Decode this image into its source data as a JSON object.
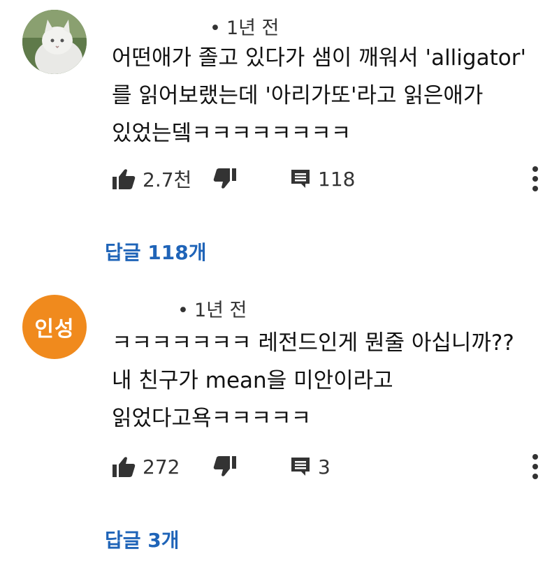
{
  "comments": [
    {
      "time": "1년 전",
      "avatar_text": "",
      "lines": [
        "어떤애가 졸고 있다가 샘이 깨워서 'alligator'",
        "를 읽어보랬는데 '아리가또'라고 읽은애가",
        "있었는뎈ㅋㅋㅋㅋㅋㅋㅋㅋ"
      ],
      "likes": "2.7천",
      "reply_count": "118",
      "replies_label": "답글 118개"
    },
    {
      "time": "1년 전",
      "avatar_text": "인성",
      "lines": [
        "ㅋㅋㅋㅋㅋㅋㅋ 레전드인게 뭔줄 아십니까??",
        "내 친구가 mean을 미안이라고",
        "읽었다고욕ㅋㅋㅋㅋㅋ"
      ],
      "likes": "272",
      "reply_count": "3",
      "replies_label": "답글 3개"
    }
  ],
  "icons": {
    "like": "thumbs-up-icon",
    "dislike": "thumbs-down-icon",
    "reply": "comment-icon",
    "more": "more-vertical-icon"
  },
  "colors": {
    "link": "#1f64b8",
    "avatar2": "#f08a1d"
  }
}
